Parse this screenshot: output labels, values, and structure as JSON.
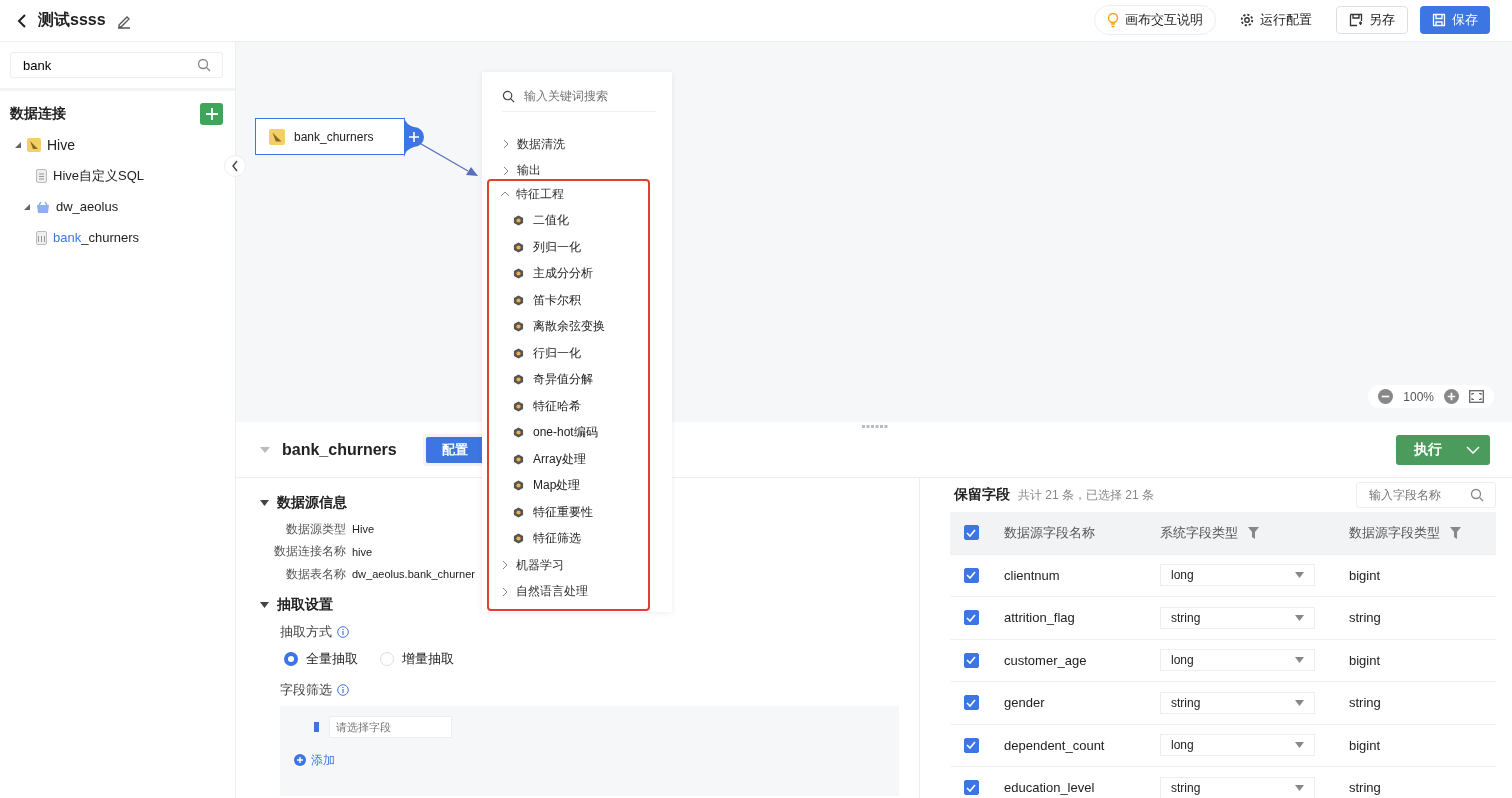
{
  "header": {
    "title": "测试ssss",
    "buttons": [
      {
        "label": "画布交互说明",
        "kind": "hint"
      },
      {
        "label": "运行配置",
        "kind": "link"
      },
      {
        "label": "另存",
        "kind": "outline"
      },
      {
        "label": "保存",
        "kind": "primary"
      }
    ]
  },
  "sidebar": {
    "search": {
      "value": "bank"
    },
    "section_title": "数据连接",
    "tree": [
      {
        "label": "Hive",
        "kind": "hive",
        "expanded": true,
        "children": [
          {
            "label": "Hive自定义SQL",
            "kind": "sql"
          },
          {
            "label": "dw_aeolus",
            "kind": "db",
            "expanded": true,
            "children": [
              {
                "match": "bank",
                "rest": "_churners",
                "kind": "table"
              }
            ]
          }
        ]
      }
    ]
  },
  "canvas": {
    "node": {
      "label": "bank_churners",
      "selected": true
    },
    "zoom": "100%"
  },
  "menu": {
    "placeholder": "输入关键词搜索",
    "groups": [
      {
        "label": "数据清洗",
        "expanded": false,
        "highlighted": false
      },
      {
        "label": "输出",
        "expanded": false,
        "highlighted": false
      },
      {
        "label": "特征工程",
        "expanded": true,
        "highlighted": true,
        "items": [
          "二值化",
          "列归一化",
          "主成分分析",
          "笛卡尔积",
          "离散余弦变换",
          "行归一化",
          "奇异值分解",
          "特征哈希",
          "one-hot编码",
          "Array处理",
          "Map处理",
          "特征重要性",
          "特征筛选"
        ]
      },
      {
        "label": "机器学习",
        "expanded": false,
        "highlighted": true
      },
      {
        "label": "自然语言处理",
        "expanded": false,
        "highlighted": true
      }
    ]
  },
  "panel": {
    "title": "bank_churners",
    "tabs": [
      {
        "label": "配置",
        "selected": true
      }
    ],
    "run_button": "执行",
    "source_section": {
      "title": "数据源信息",
      "expanded": true,
      "fields": [
        {
          "label": "数据源类型",
          "value": "Hive"
        },
        {
          "label": "数据连接名称",
          "value": "hive"
        },
        {
          "label": "数据表名称",
          "value": "dw_aeolus.bank_churner"
        }
      ]
    },
    "extract_section": {
      "title": "抽取设置",
      "expanded": true,
      "mode_label": "抽取方式",
      "modes": [
        {
          "label": "全量抽取",
          "selected": true
        },
        {
          "label": "增量抽取",
          "selected": false
        }
      ],
      "filter_label": "字段筛选",
      "filter_placeholder": "请选择字段",
      "add_label": "添加"
    },
    "fields": {
      "title": "保留字段",
      "summary": "共计 21 条，已选择 21 条",
      "search_placeholder": "输入字段名称",
      "all_checked": true,
      "columns": [
        "数据源字段名称",
        "系统字段类型",
        "数据源字段类型"
      ],
      "rows": [
        {
          "name": "clientnum",
          "sys_type": "long",
          "src_type": "bigint",
          "checked": true
        },
        {
          "name": "attrition_flag",
          "sys_type": "string",
          "src_type": "string",
          "checked": true
        },
        {
          "name": "customer_age",
          "sys_type": "long",
          "src_type": "bigint",
          "checked": true
        },
        {
          "name": "gender",
          "sys_type": "string",
          "src_type": "string",
          "checked": true
        },
        {
          "name": "dependent_count",
          "sys_type": "long",
          "src_type": "bigint",
          "checked": true
        },
        {
          "name": "education_level",
          "sys_type": "string",
          "src_type": "string",
          "checked": true
        }
      ]
    }
  }
}
